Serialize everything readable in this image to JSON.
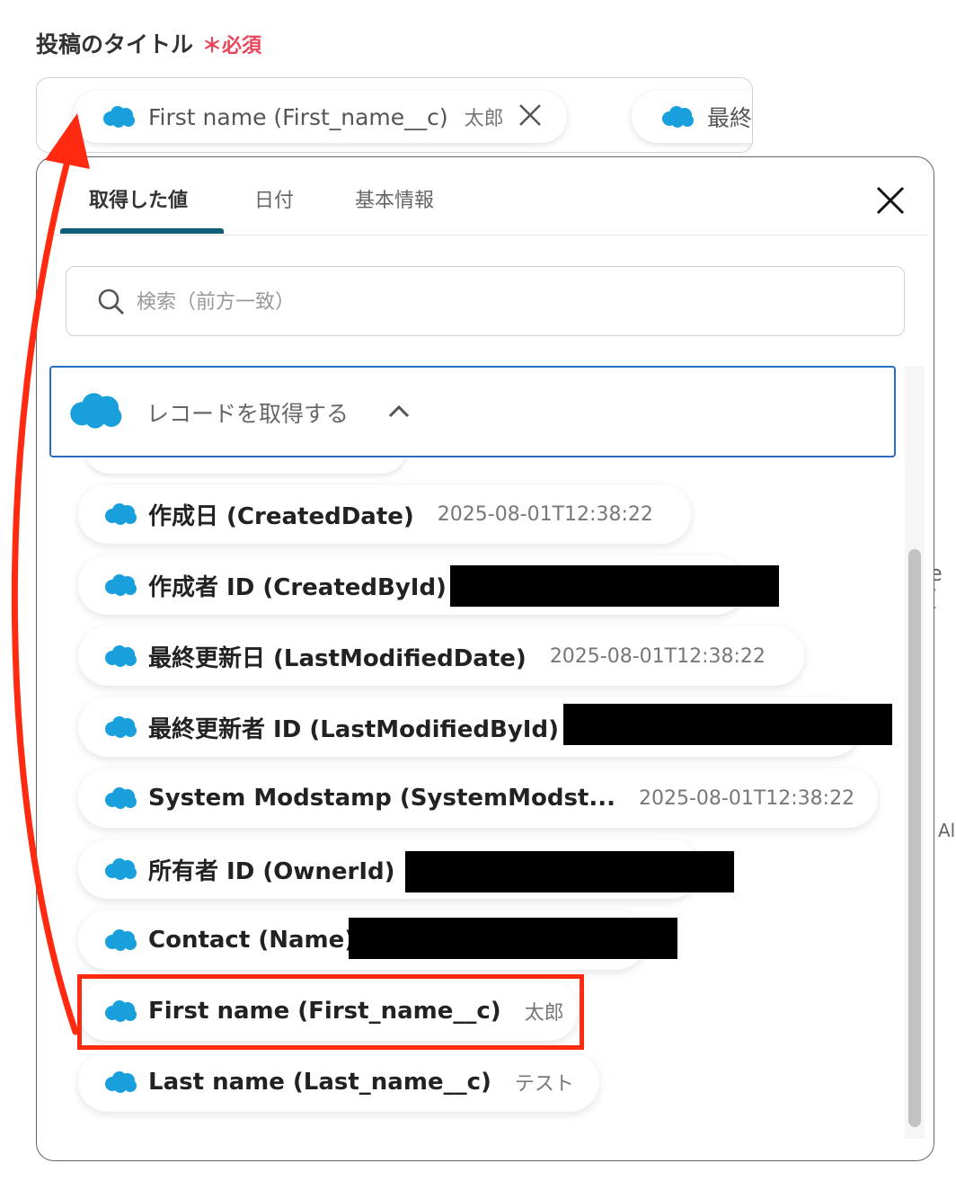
{
  "field": {
    "label": "投稿のタイトル",
    "required_star": "＊",
    "required_text": "必須",
    "chips": [
      {
        "icon": "salesforce-cloud-icon",
        "name": "First name (First_name__c)",
        "value": "太郎",
        "remove_icon": "close-icon"
      },
      {
        "icon": "salesforce-cloud-icon",
        "name": "最終"
      }
    ]
  },
  "panel": {
    "tabs": [
      {
        "label": "取得した値",
        "active": true
      },
      {
        "label": "日付",
        "active": false
      },
      {
        "label": "基本情報",
        "active": false
      }
    ],
    "close_icon": "close-icon",
    "search": {
      "placeholder": "検索（前方一致）",
      "value": "",
      "icon": "search-icon"
    },
    "group": {
      "title": "レコードを取得する",
      "icon": "salesforce-cloud-icon",
      "expand_icon": "chevron-up-icon"
    },
    "items": [
      {
        "name": "作成日 (CreatedDate)",
        "value": "2025-08-01T12:38:22",
        "redacted": false
      },
      {
        "name": "作成者 ID (CreatedById)",
        "value": "",
        "redacted": true
      },
      {
        "name": "最終更新日 (LastModifiedDate)",
        "value": "2025-08-01T12:38:22",
        "redacted": false
      },
      {
        "name": "最終更新者 ID (LastModifiedById)",
        "value": "",
        "redacted": true
      },
      {
        "name": "System Modstamp (SystemModst...",
        "value": "2025-08-01T12:38:22",
        "redacted": false
      },
      {
        "name": "所有者 ID (OwnerId)",
        "value": "",
        "redacted": true
      },
      {
        "name": "Contact (Name)",
        "value": "",
        "redacted": true
      },
      {
        "name": "First name (First_name__c)",
        "value": "太郎",
        "redacted": false,
        "highlighted": true
      },
      {
        "name": "Last name (Last_name__c)",
        "value": "テスト",
        "redacted": false
      }
    ]
  },
  "background_fragments": [
    "e (",
    "Al"
  ],
  "annotation": {
    "highlight_color": "#ff2a0f",
    "arrow_color": "#ff2a0f"
  },
  "colors": {
    "salesforce": "#19a0dc",
    "accent_tab": "#0e5e7a",
    "group_border": "#2a6cc4",
    "required": "#e8455a"
  }
}
